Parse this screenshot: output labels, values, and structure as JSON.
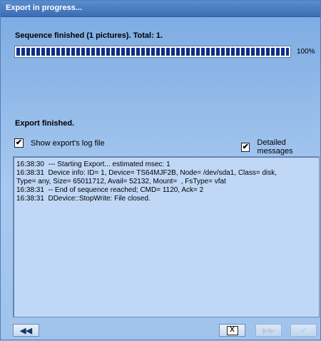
{
  "window": {
    "title": "Export in progress..."
  },
  "status_text": "Sequence finished (1 pictures). Total: 1.",
  "progress": {
    "percent_label": "100%",
    "value": 1.0
  },
  "finished_text": "Export finished.",
  "options": {
    "show_log": {
      "label": "Show export's log file",
      "checked": true
    },
    "detailed": {
      "label": "Detailed messages",
      "checked": true
    }
  },
  "log": [
    "16:38:30  --- Starting Export... estimated msec: 1",
    "16:38:31  Device info: ID= 1, Device= TS64MJF2B, Node= /dev/sda1, Class= disk,",
    "Type= any, Size= 65011712, Avail= 52132, Mount=  , FsType= vfat",
    "16:38:31  -- End of sequence reached; CMD= 1120, Ack= 2",
    "16:38:31  DDevice::StopWrite: File closed."
  ],
  "footer": {
    "back_icon": "double-left-arrow-icon",
    "back_label": "◀◀",
    "cancel_icon": "close-icon",
    "cancel_label": "X",
    "forward_icon": "double-right-arrow-icon",
    "forward_label": "▶▶",
    "confirm_icon": "checkmark-icon",
    "confirm_label": "✓"
  }
}
